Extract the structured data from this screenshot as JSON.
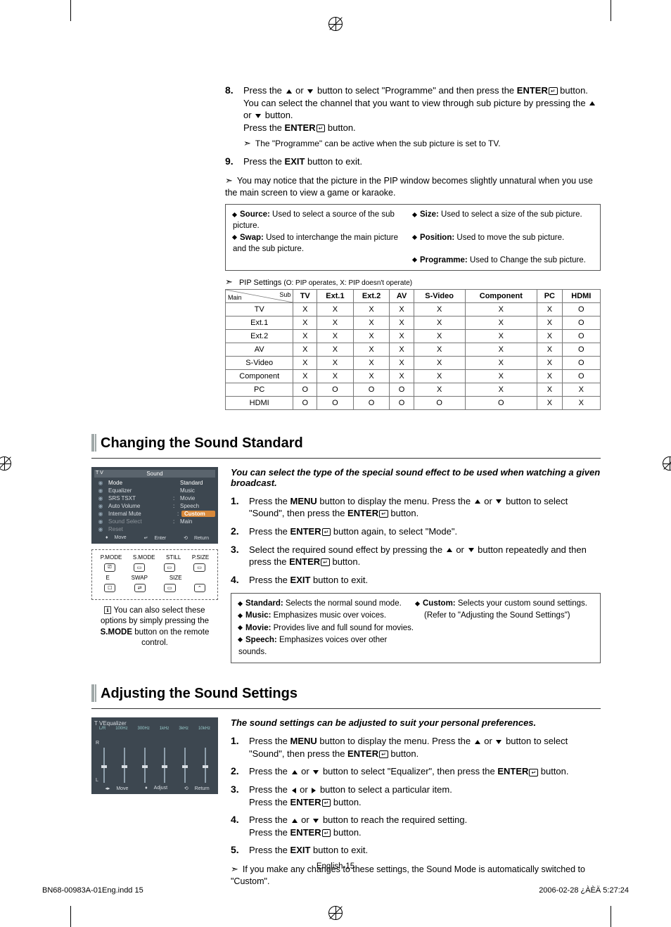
{
  "page_number": "English-15",
  "footer_left": "BN68-00983A-01Eng.indd   15",
  "footer_right": "2006-02-28   ¿ÀÈÄ 5:27:24",
  "top_steps": {
    "step8": {
      "num": "8.",
      "line1a": "Press the ",
      "line1b": " or ",
      "line1c": " button to select \"Programme\" and then press the ",
      "line2a": "ENTER",
      "line2b": " button. You can select the channel that you want to view through sub picture by pressing the ",
      "line2c": " or ",
      "line2d": " button.",
      "line3a": "Press the ",
      "line3b": "ENTER",
      "line3c": " button.",
      "note": "The \"Programme\" can be active when the sub picture is set to TV."
    },
    "step9": {
      "num": "9.",
      "text_a": "Press the ",
      "text_b": "EXIT",
      "text_c": " button to exit."
    },
    "bottom_note": "You may notice that the picture in the PIP window becomes slightly unnatural when you use the main screen to view a game or karaoke."
  },
  "info_defs": {
    "source_lbl": "Source:",
    "source_txt": " Used to select a source of the sub picture.",
    "size_lbl": "Size:",
    "size_txt": " Used to select a size of the sub picture.",
    "swap_lbl": "Swap:",
    "swap_txt": " Used to interchange the main picture and the sub picture.",
    "position_lbl": "Position:",
    "position_txt": " Used to move the sub picture.",
    "programme_lbl": "Programme:",
    "programme_txt": " Used to Change the sub picture."
  },
  "pip_title": "PIP Settings ",
  "pip_legend": "(O: PIP operates, X: PIP doesn't operate)",
  "pip_headers": [
    "TV",
    "Ext.1",
    "Ext.2",
    "AV",
    "S-Video",
    "Component",
    "PC",
    "HDMI"
  ],
  "pip_corner_main": "Main",
  "pip_corner_sub": "Sub",
  "pip_rows": [
    {
      "label": "TV",
      "cells": [
        "X",
        "X",
        "X",
        "X",
        "X",
        "X",
        "X",
        "O"
      ]
    },
    {
      "label": "Ext.1",
      "cells": [
        "X",
        "X",
        "X",
        "X",
        "X",
        "X",
        "X",
        "O"
      ]
    },
    {
      "label": "Ext.2",
      "cells": [
        "X",
        "X",
        "X",
        "X",
        "X",
        "X",
        "X",
        "O"
      ]
    },
    {
      "label": "AV",
      "cells": [
        "X",
        "X",
        "X",
        "X",
        "X",
        "X",
        "X",
        "O"
      ]
    },
    {
      "label": "S-Video",
      "cells": [
        "X",
        "X",
        "X",
        "X",
        "X",
        "X",
        "X",
        "O"
      ]
    },
    {
      "label": "Component",
      "cells": [
        "X",
        "X",
        "X",
        "X",
        "X",
        "X",
        "X",
        "O"
      ]
    },
    {
      "label": "PC",
      "cells": [
        "O",
        "O",
        "O",
        "O",
        "X",
        "X",
        "X",
        "X"
      ]
    },
    {
      "label": "HDMI",
      "cells": [
        "O",
        "O",
        "O",
        "O",
        "O",
        "O",
        "X",
        "X"
      ]
    }
  ],
  "section1": {
    "title": "Changing the Sound Standard",
    "intro": "You can select the type of the special sound effect to be used when watching a given broadcast.",
    "steps": [
      {
        "n": "1.",
        "a": "Press the ",
        "b": "MENU",
        "c": " button to display the menu. Press the ",
        "d": " or ",
        "e": " button to select \"Sound\", then press the ",
        "f": "ENTER",
        "g": " button."
      },
      {
        "n": "2.",
        "a": "Press the ",
        "b": "ENTER",
        "c": " button again, to select \"Mode\"."
      },
      {
        "n": "3.",
        "a": "Select the required sound effect by pressing the ",
        "b": " or ",
        "c": " button repeatedly and then press the ",
        "d": "ENTER",
        "e": " button."
      },
      {
        "n": "4.",
        "a": "Press the ",
        "b": "EXIT",
        "c": " button to exit."
      }
    ],
    "defs": {
      "standard_lbl": "Standard:",
      "standard_txt": " Selects the normal sound mode.",
      "music_lbl": "Music:",
      "music_txt": " Emphasizes music over voices.",
      "movie_lbl": "Movie:",
      "movie_txt": " Provides live and full sound for movies.",
      "speech_lbl": "Speech:",
      "speech_txt": " Emphasizes voices over other sounds.",
      "custom_lbl": "Custom:",
      "custom_txt": " Selects your custom sound settings.",
      "custom_ref": "(Refer to \"Adjusting the Sound Settings\")"
    },
    "caption_a": "You can also select these options by simply pressing the ",
    "caption_b": "S.MODE",
    "caption_c": " button on the remote control."
  },
  "osd_sound": {
    "corner": "T V",
    "title": "Sound",
    "rows": [
      {
        "label": "Mode",
        "val": "Standard",
        "hl": false,
        "white": true
      },
      {
        "label": "Equalizer",
        "val": "Music",
        "hl": false
      },
      {
        "label": "SRS TSXT",
        "val": "Movie",
        "hl": false,
        "colon": ":"
      },
      {
        "label": "Auto Volume",
        "val": "Speech",
        "hl": false,
        "colon": ":"
      },
      {
        "label": "Internal Mute",
        "val": "Custom",
        "hl": true,
        "colon": ":"
      },
      {
        "label": "Sound Select",
        "val": "Main",
        "hl": false,
        "colon": ":",
        "dim": true
      },
      {
        "label": "Reset",
        "val": "",
        "hl": false,
        "dim": true
      }
    ],
    "foot": [
      "Move",
      "Enter",
      "Return"
    ]
  },
  "remote": {
    "row1": [
      "P.MODE",
      "S.MODE",
      "STILL",
      "P.SIZE"
    ],
    "row2": [
      "E",
      "SWAP",
      "SIZE",
      ""
    ]
  },
  "section2": {
    "title": "Adjusting the Sound Settings",
    "intro": "The sound settings can be adjusted to suit your personal preferences.",
    "steps": [
      {
        "n": "1.",
        "a": "Press the ",
        "b": "MENU",
        "c": " button to display the menu. Press the ",
        "d": " or ",
        "e": " button to select \"Sound\", then press the ",
        "f": "ENTER",
        "g": " button."
      },
      {
        "n": "2.",
        "a": "Press the ",
        "b": " or ",
        "c": " button to select \"Equalizer\", then press the ",
        "d": "ENTER",
        "e": " button."
      },
      {
        "n": "3.",
        "a": "Press the ",
        "b": " or ",
        "c": " button to select a particular item.",
        "d": "Press the ",
        "e": "ENTER",
        "f": " button."
      },
      {
        "n": "4.",
        "a": "Press the ",
        "b": " or ",
        "c": " button to reach the required setting.",
        "d": "Press the ",
        "e": "ENTER",
        "f": " button."
      },
      {
        "n": "5.",
        "a": "Press the ",
        "b": "EXIT",
        "c": " button to exit."
      }
    ],
    "note": "If you make any changes to these settings, the Sound Mode is automatically switched to \"Custom\"."
  },
  "osd_eq": {
    "corner": "T V",
    "title": "Equalizer",
    "bands": [
      "L/R",
      "100Hz",
      "300Hz",
      "1kHz",
      "3kHz",
      "10kHz"
    ],
    "scale": [
      "R",
      "",
      "L"
    ],
    "foot": [
      "Move",
      "Adjust",
      "Return"
    ]
  }
}
